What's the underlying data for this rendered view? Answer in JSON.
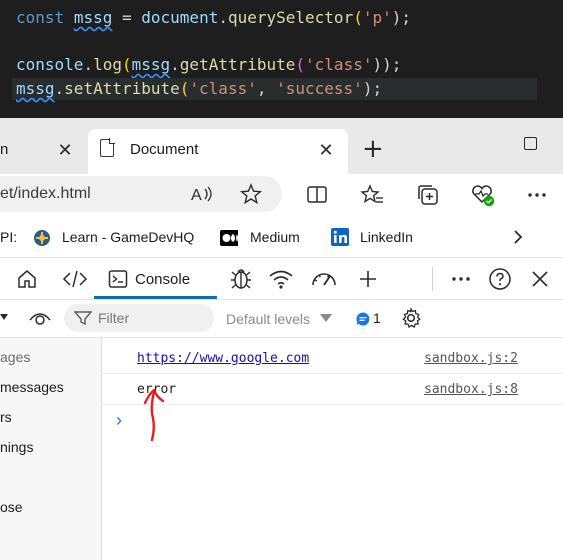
{
  "editor": {
    "line1": {
      "kw": "const",
      "var": "mssg",
      "eq": "=",
      "obj": "document",
      "fn": "querySelector",
      "arg": "'p'",
      "end": ");"
    },
    "line2": {
      "obj": "console",
      "fn": "log",
      "var": "mssg",
      "fn2": "getAttribute",
      "arg": "'class'",
      "end": "));"
    },
    "line3": {
      "var": "mssg",
      "fn": "setAttribute",
      "arg1": "'class'",
      "arg2": "'success'",
      "end": ");"
    }
  },
  "tabs": {
    "left_tab_text": "n",
    "active_title": "Document",
    "close_glyph": "✕",
    "newtab_glyph": "+"
  },
  "address": {
    "url": "et/index.html"
  },
  "favorites": [
    {
      "label": "PI:"
    },
    {
      "label": "Learn - GameDevHQ"
    },
    {
      "label": "Medium"
    },
    {
      "label": "LinkedIn"
    }
  ],
  "devtools": {
    "console_label": "Console"
  },
  "filterbar": {
    "filter_placeholder": "Filter",
    "levels": "Default levels",
    "issues_count": "1"
  },
  "sidebar": {
    "items": [
      "ages",
      "messages",
      "rs",
      "nings",
      "",
      "ose"
    ]
  },
  "console": {
    "messages": [
      {
        "text": "https://www.google.com",
        "source": "sandbox.js:2"
      },
      {
        "text": "error",
        "source": "sandbox.js:8"
      }
    ],
    "prompt": "›"
  },
  "colors": {
    "editor_bg": "#1e1e1e",
    "accent": "#0f6cbd",
    "annotation": "#e81e1e"
  }
}
